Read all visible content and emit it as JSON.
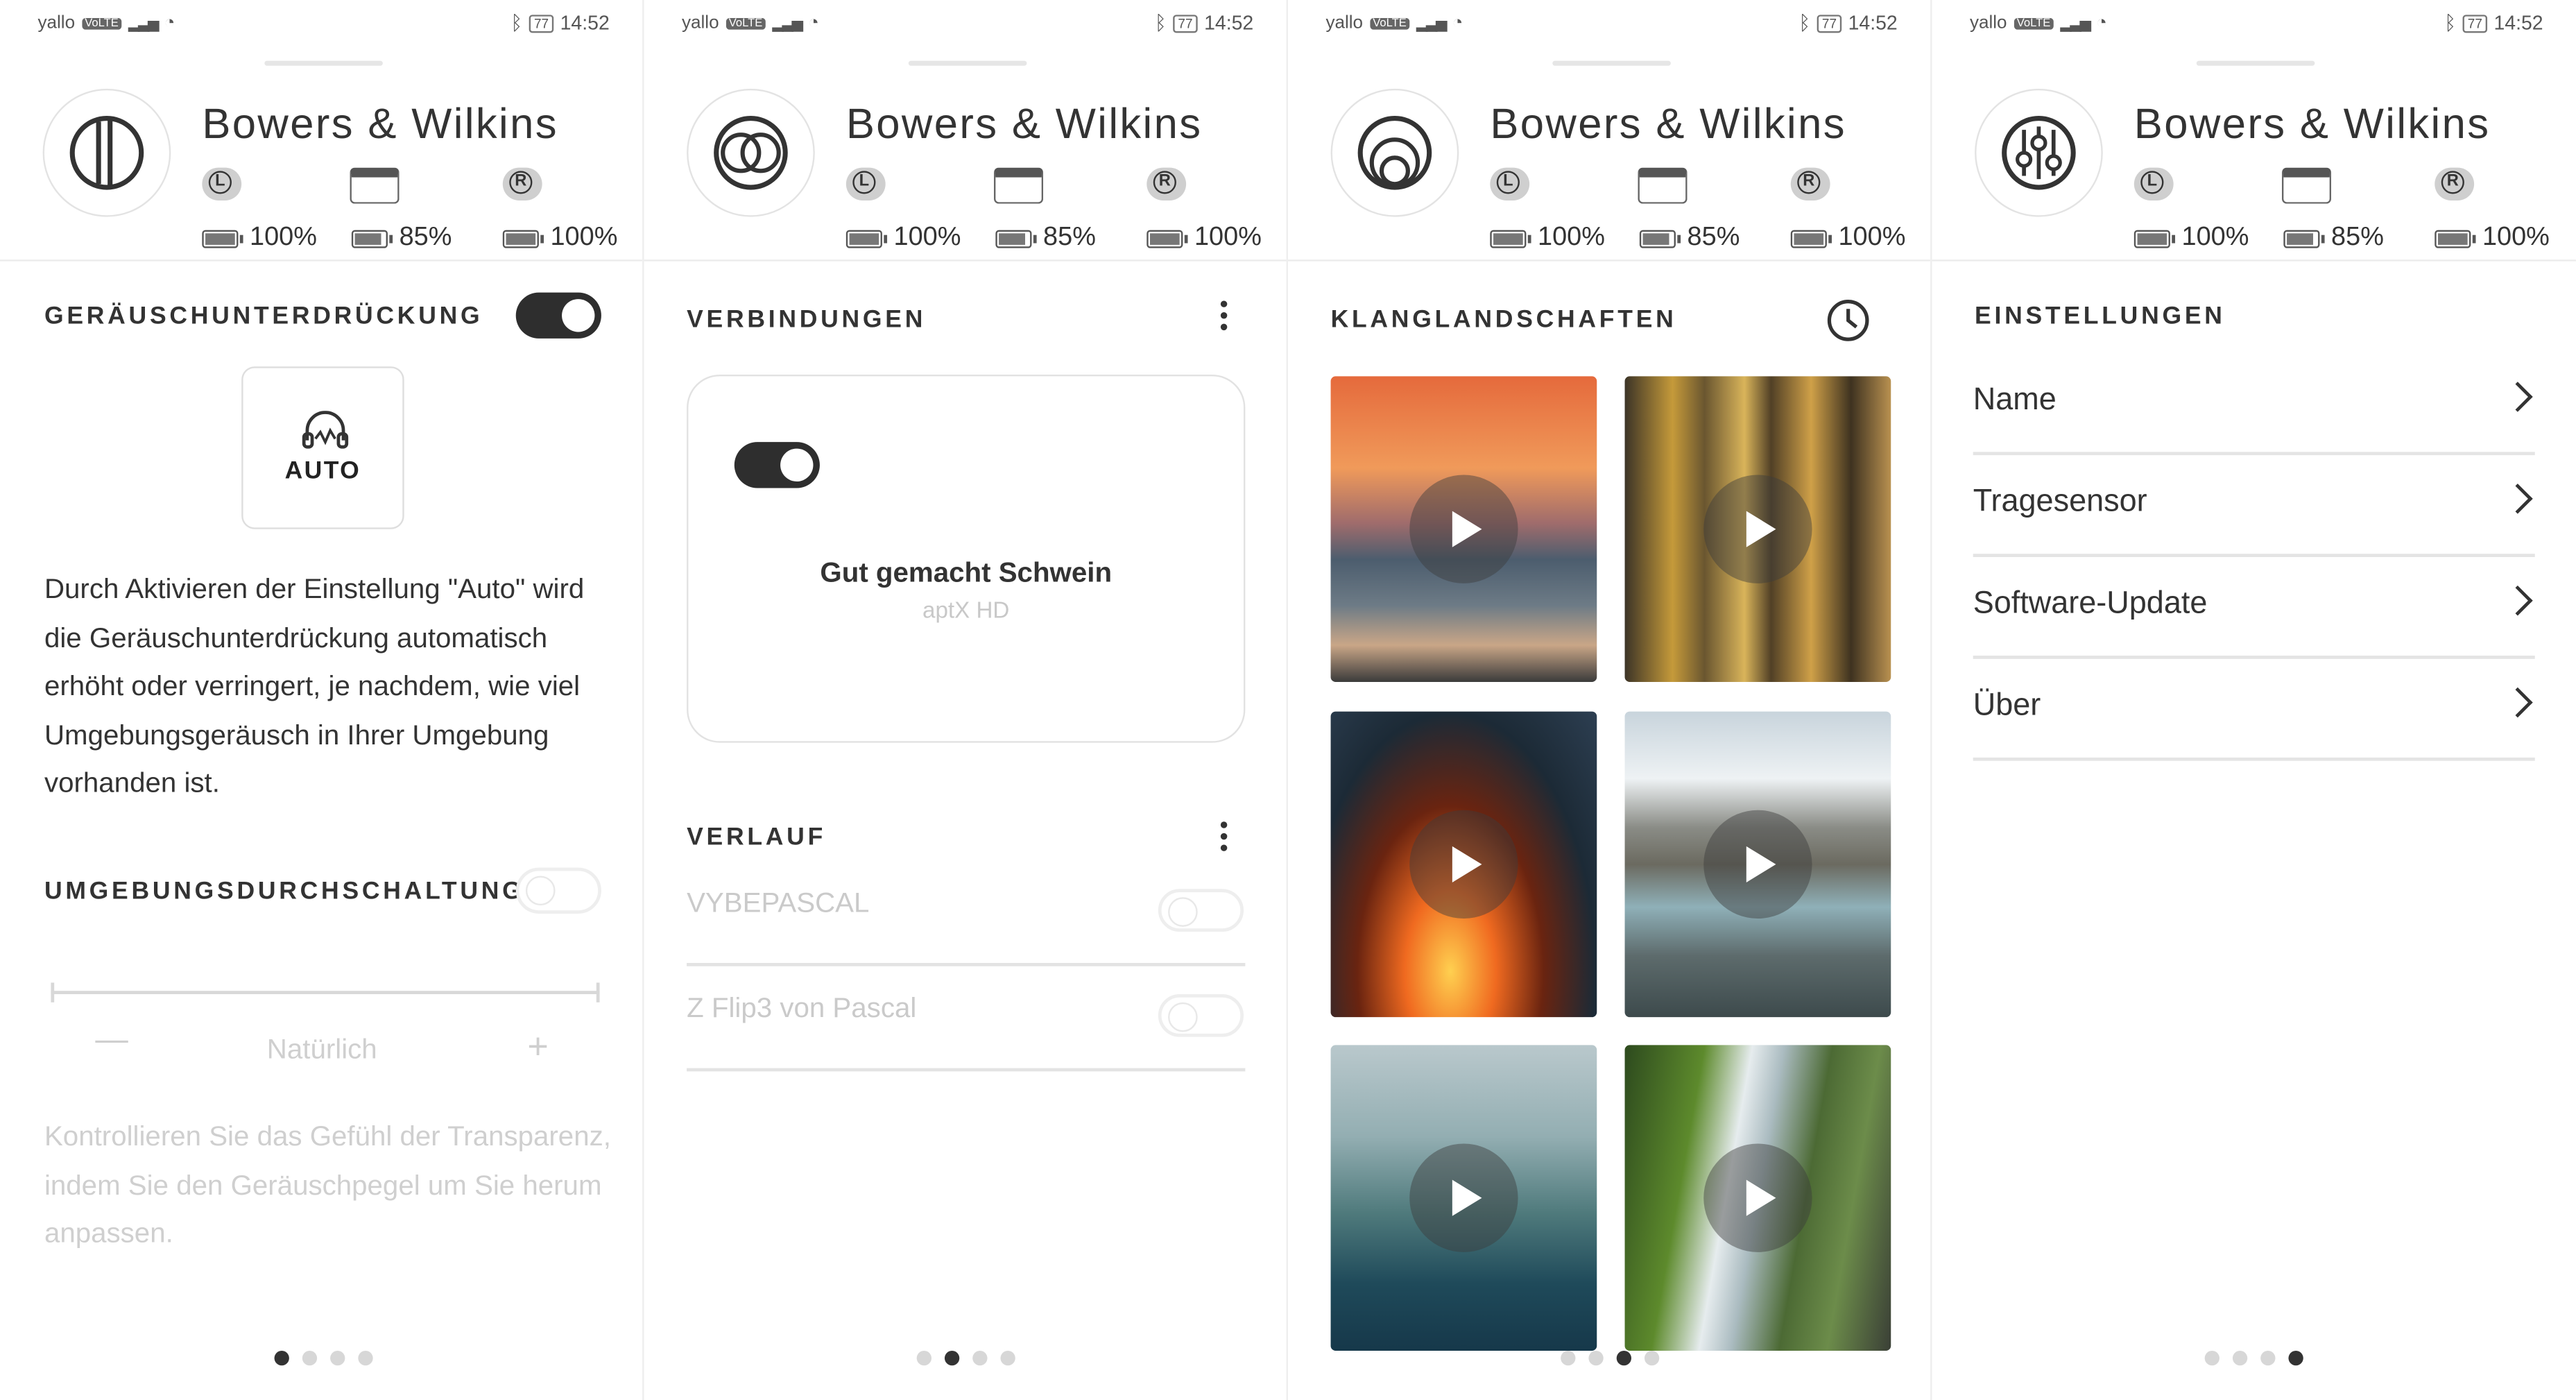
{
  "status_bar": {
    "carrier": "yallo",
    "volte": "VoLTE",
    "time": "14:52",
    "battery": "77"
  },
  "header": {
    "brand": "Bowers & Wilkins",
    "left_label": "L",
    "right_label": "R",
    "battery_left": "100%",
    "battery_case": "85%",
    "battery_right": "100%"
  },
  "panel_noise": {
    "title": "GERÄUSCHUNTERDRÜCKUNG",
    "anc_enabled": true,
    "auto_label": "AUTO",
    "description": "Durch Aktivieren der Einstellung \"Auto\" wird die Geräuschunterdrückung automatisch erhöht oder verringert, je nachdem, wie viel Umgebungsgeräusch in Ihrer Umgebung vorhanden ist.",
    "ambient_title": "UMGEBUNGSDURCHSCHALTUNG",
    "ambient_enabled": false,
    "slider_minus": "—",
    "slider_label": "Natürlich",
    "slider_plus": "+",
    "ambient_description": "Kontrollieren Sie das Gefühl der Transparenz, indem Sie den Geräuschpegel um Sie herum anpassen.",
    "page_index": 0
  },
  "panel_connections": {
    "title": "VERBINDUNGEN",
    "connected_enabled": true,
    "device_name": "Gut gemacht Schwein",
    "codec": "aptX HD",
    "history_title": "VERLAUF",
    "history": [
      {
        "name": "VYBEPASCAL",
        "enabled": false
      },
      {
        "name": "Z Flip3 von Pascal",
        "enabled": false
      }
    ],
    "page_index": 1
  },
  "panel_soundscapes": {
    "title": "KLANGLANDSCHAFTEN",
    "tiles": [
      {
        "scene": "sunset-beach"
      },
      {
        "scene": "autumn-forest"
      },
      {
        "scene": "campfire"
      },
      {
        "scene": "mountain-river"
      },
      {
        "scene": "rain-on-glass"
      },
      {
        "scene": "waterfall"
      }
    ],
    "page_index": 2
  },
  "panel_settings": {
    "title": "EINSTELLUNGEN",
    "items": [
      {
        "label": "Name"
      },
      {
        "label": "Tragesensor"
      },
      {
        "label": "Software-Update"
      },
      {
        "label": "Über"
      }
    ],
    "page_index": 3
  },
  "colors": {
    "accent_dark": "#2e2e2e",
    "text": "#333333",
    "muted": "#cfcfcf"
  },
  "icons": {
    "panel_noise_logo": "noise-cancel-icon",
    "panel_connections_logo": "linked-circles-icon",
    "panel_soundscapes_logo": "concentric-circles-icon",
    "panel_settings_logo": "equalizer-icon"
  }
}
